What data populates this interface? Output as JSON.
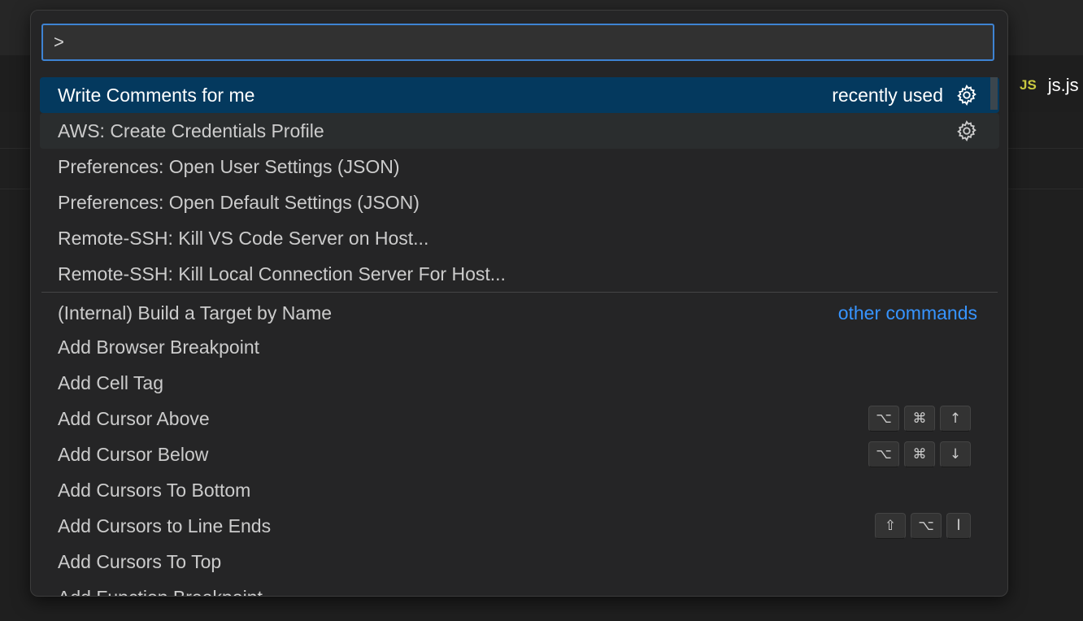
{
  "background": {
    "tab": {
      "icon": "JS",
      "label": "js.js"
    }
  },
  "palette": {
    "input_value": ">",
    "recent": [
      {
        "label": "Write Comments for me",
        "meta": "recently used",
        "gear": true,
        "selected": true
      },
      {
        "label": "AWS: Create Credentials Profile",
        "gear": true,
        "hover": true
      },
      {
        "label": "Preferences: Open User Settings (JSON)"
      },
      {
        "label": "Preferences: Open Default Settings (JSON)"
      },
      {
        "label": "Remote-SSH: Kill VS Code Server on Host..."
      },
      {
        "label": "Remote-SSH: Kill Local Connection Server For Host..."
      }
    ],
    "other_commands_label": "other commands",
    "other": [
      {
        "label": "(Internal) Build a Target by Name"
      },
      {
        "label": "Add Browser Breakpoint"
      },
      {
        "label": "Add Cell Tag"
      },
      {
        "label": "Add Cursor Above",
        "keys": [
          "⌥",
          "⌘",
          "↑"
        ]
      },
      {
        "label": "Add Cursor Below",
        "keys": [
          "⌥",
          "⌘",
          "↓"
        ]
      },
      {
        "label": "Add Cursors To Bottom"
      },
      {
        "label": "Add Cursors to Line Ends",
        "keys": [
          "⇧",
          "⌥",
          "I"
        ]
      },
      {
        "label": "Add Cursors To Top"
      },
      {
        "label": "Add Function Breakpoint"
      }
    ]
  }
}
